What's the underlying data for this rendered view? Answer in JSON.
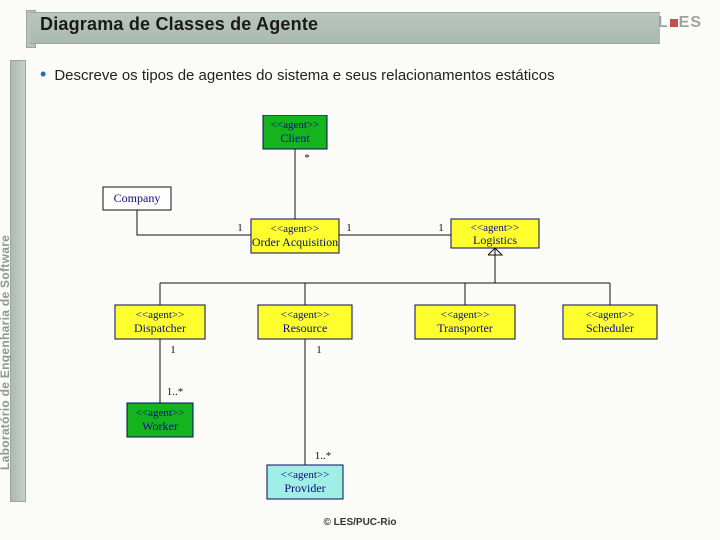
{
  "header": {
    "title": "Diagrama de Classes de Agente",
    "logo_text": "LES"
  },
  "sidebar": {
    "vertical_label": "Laboratório de Engenharia de Software"
  },
  "body": {
    "bullet1": "Descreve os tipos de agentes do sistema e seus relacionamentos estáticos"
  },
  "diagram": {
    "boxes": {
      "client": {
        "stereo": "<<agent>>",
        "name": "Client"
      },
      "company": {
        "stereo": "",
        "name": "Company"
      },
      "orderAcquisition": {
        "stereo": "<<agent>>",
        "name": "Order Acquisition"
      },
      "logistics": {
        "stereo": "<<agent>>",
        "name": "Logistics"
      },
      "dispatcher": {
        "stereo": "<<agent>>",
        "name": "Dispatcher"
      },
      "resource": {
        "stereo": "<<agent>>",
        "name": "Resource"
      },
      "transporter": {
        "stereo": "<<agent>>",
        "name": "Transporter"
      },
      "scheduler": {
        "stereo": "<<agent>>",
        "name": "Scheduler"
      },
      "worker": {
        "stereo": "<<agent>>",
        "name": "Worker"
      },
      "provider": {
        "stereo": "<<agent>>",
        "name": "Provider"
      }
    },
    "multiplicities": {
      "client_star": "*",
      "company_one": "1",
      "order_one_l": "1",
      "order_one_r": "1",
      "dispatcher_one": "1",
      "resource_one": "1",
      "worker_range": "1..*",
      "provider_range": "1..*"
    }
  },
  "footer": {
    "copy": "© LES/PUC-Rio"
  }
}
